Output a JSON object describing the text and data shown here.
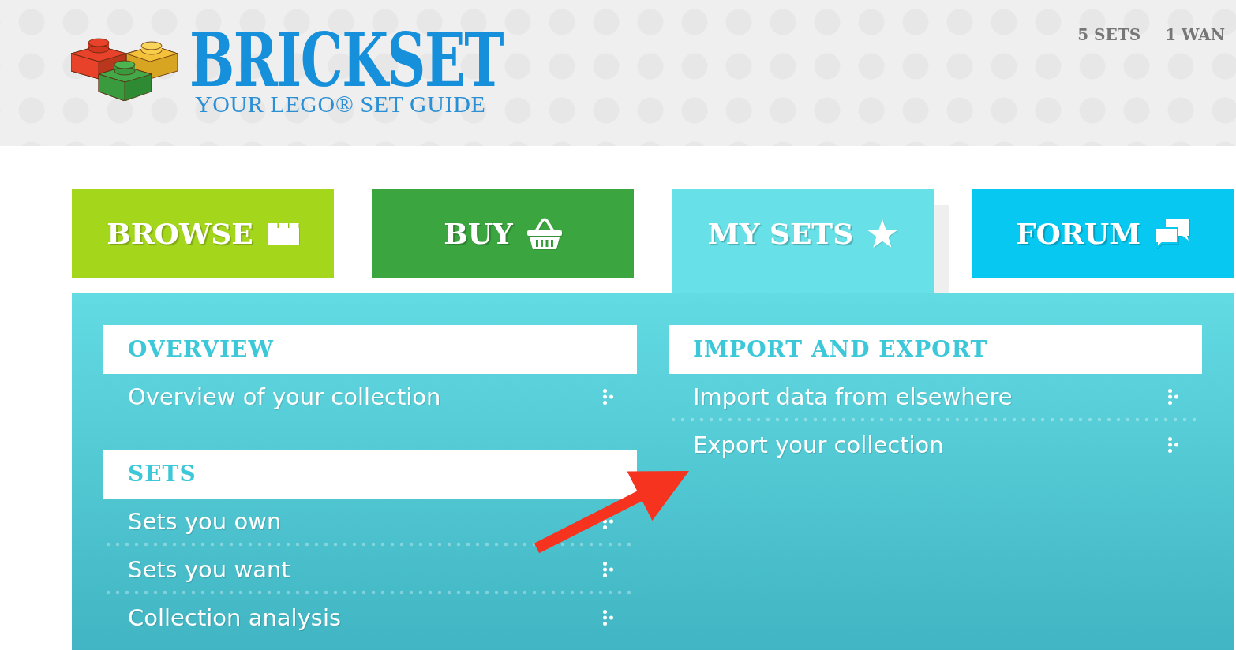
{
  "header": {
    "logo": {
      "title": "BRICKSET",
      "tagline": "YOUR LEGO® SET GUIDE"
    },
    "counts": [
      "5 SETS",
      "1 WAN"
    ]
  },
  "nav": {
    "tabs": [
      {
        "label": "BROWSE",
        "color": "#a4d61c",
        "selected": false
      },
      {
        "label": "BUY",
        "color": "#3ba63f",
        "selected": false
      },
      {
        "label": "MY SETS",
        "color": "#67e0e7",
        "selected": true
      },
      {
        "label": "FORUM",
        "color": "#07c8f0",
        "selected": false
      }
    ]
  },
  "menu": {
    "columns": [
      {
        "sections": [
          {
            "title": "OVERVIEW",
            "items": [
              "Overview of your collection"
            ]
          },
          {
            "title": "SETS",
            "items": [
              "Sets you own",
              "Sets you want",
              "Collection analysis"
            ]
          }
        ]
      },
      {
        "sections": [
          {
            "title": "IMPORT AND EXPORT",
            "items": [
              "Import data from elsewhere",
              "Export your collection"
            ]
          }
        ]
      }
    ]
  },
  "annotations": [
    {
      "kind": "arrow"
    }
  ]
}
